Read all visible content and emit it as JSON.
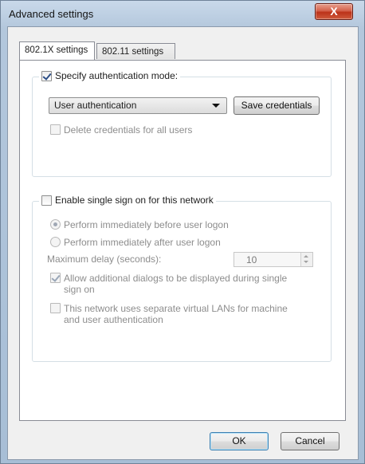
{
  "window": {
    "title": "Advanced settings",
    "close_glyph": "X"
  },
  "tabs": [
    {
      "label": "802.1X settings",
      "active": true
    },
    {
      "label": "802.11 settings",
      "active": false
    }
  ],
  "auth_group": {
    "specify_label": "Specify authentication mode:",
    "specify_checked": true,
    "mode_selected": "User authentication",
    "save_credentials_label": "Save credentials",
    "delete_credentials_label": "Delete credentials for all users",
    "delete_credentials_checked": false
  },
  "sso_group": {
    "enable_label": "Enable single sign on for this network",
    "enable_checked": false,
    "perform_before_label": "Perform immediately before user logon",
    "perform_before_selected": true,
    "perform_after_label": "Perform immediately after user logon",
    "perform_after_selected": false,
    "max_delay_label": "Maximum delay (seconds):",
    "max_delay_value": "10",
    "allow_dialogs_label_line1": "Allow additional dialogs to be displayed during single",
    "allow_dialogs_label_line2": "sign on",
    "allow_dialogs_checked": true,
    "vlan_label_line1": "This network uses separate virtual LANs for machine",
    "vlan_label_line2": "and user authentication",
    "vlan_checked": false
  },
  "buttons": {
    "ok": "OK",
    "cancel": "Cancel"
  },
  "colors": {
    "titlebar": "#b3c7dc",
    "close_button": "#c84a30",
    "accent_border": "#3c7fb1"
  }
}
